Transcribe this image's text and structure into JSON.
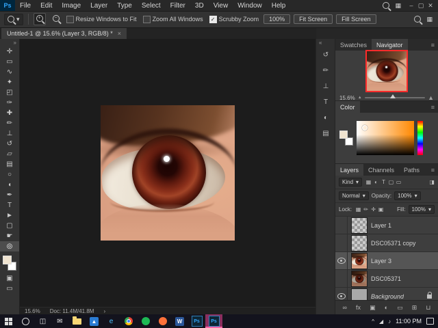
{
  "app": {
    "logo": "Ps"
  },
  "ui": {
    "caret": "▾",
    "panel_menu": "≡",
    "workspace_glyph": "▦",
    "check_glyph": "✓"
  },
  "menu_bar": {
    "items": [
      "File",
      "Edit",
      "Image",
      "Layer",
      "Type",
      "Select",
      "Filter",
      "3D",
      "View",
      "Window",
      "Help"
    ]
  },
  "window_controls": [
    {
      "name": "minimize",
      "glyph": "–"
    },
    {
      "name": "restore",
      "glyph": "▢"
    },
    {
      "name": "close",
      "glyph": "✕"
    }
  ],
  "options_bar": {
    "zoom_in_glyph": "+",
    "zoom_out_glyph": "−",
    "checkboxes": [
      {
        "label": "Resize Windows to Fit",
        "checked": false
      },
      {
        "label": "Zoom All Windows",
        "checked": false
      },
      {
        "label": "Scrubby Zoom",
        "checked": true
      }
    ],
    "buttons": [
      "100%",
      "Fit Screen",
      "Fill Screen"
    ]
  },
  "document": {
    "tab_title": "Untitled-1 @ 15.6% (Layer 3, RGB/8) *",
    "close_glyph": "×",
    "status_zoom": "15.6%",
    "status_doc": "Doc: 11.4M/41.8M",
    "status_expand_glyph": "›"
  },
  "toolbar": {
    "collapse_glyph": "»",
    "foreground_color": "#f0e4d0",
    "background_color": "#ffffff",
    "tools": [
      {
        "name": "move",
        "glyph": "✛"
      },
      {
        "name": "rectangular-marquee",
        "glyph": "▭"
      },
      {
        "name": "lasso",
        "glyph": "∿"
      },
      {
        "name": "quick-selection",
        "glyph": "✦"
      },
      {
        "name": "crop",
        "glyph": "◰"
      },
      {
        "name": "eyedropper",
        "glyph": "✑"
      },
      {
        "name": "spot-healing-brush",
        "glyph": "✚"
      },
      {
        "name": "brush",
        "glyph": "✏"
      },
      {
        "name": "clone-stamp",
        "glyph": "⊥"
      },
      {
        "name": "history-brush",
        "glyph": "↺"
      },
      {
        "name": "eraser",
        "glyph": "▱"
      },
      {
        "name": "gradient",
        "glyph": "▤"
      },
      {
        "name": "blur",
        "glyph": "○"
      },
      {
        "name": "dodge",
        "glyph": "◖"
      },
      {
        "name": "pen",
        "glyph": "✒"
      },
      {
        "name": "type",
        "glyph": "T"
      },
      {
        "name": "path-selection",
        "glyph": "►"
      },
      {
        "name": "rectangle",
        "glyph": "▢"
      },
      {
        "name": "hand",
        "glyph": "☛"
      },
      {
        "name": "zoom",
        "glyph": "◎",
        "active": true
      }
    ],
    "extra": [
      {
        "name": "quick-mask",
        "glyph": "▣"
      },
      {
        "name": "screen-mode",
        "glyph": "▭"
      }
    ]
  },
  "panel_strip": {
    "collapse_glyph": "«",
    "icons": [
      {
        "name": "history",
        "glyph": "↺"
      },
      {
        "name": "brush-settings",
        "glyph": "✏"
      },
      {
        "name": "clone-source",
        "glyph": "⊥"
      },
      {
        "name": "character",
        "glyph": "T"
      },
      {
        "name": "adjustments",
        "glyph": "◐"
      },
      {
        "name": "info",
        "glyph": "▤"
      }
    ]
  },
  "navigator": {
    "tabs": [
      {
        "label": "Swatches",
        "active": false
      },
      {
        "label": "Navigator",
        "active": true
      }
    ],
    "zoom": "15.6%",
    "zoom_out_glyph": "▲",
    "zoom_in_glyph": "▲"
  },
  "color_panel": {
    "tab": "Color"
  },
  "layers_panel": {
    "tabs": [
      {
        "label": "Layers",
        "active": true
      },
      {
        "label": "Channels",
        "active": false
      },
      {
        "label": "Paths",
        "active": false
      }
    ],
    "filter_label": "Kind",
    "filter_icons": [
      {
        "name": "pixel-layer-filter",
        "glyph": "▦"
      },
      {
        "name": "adjustment-layer-filter",
        "glyph": "◐"
      },
      {
        "name": "type-layer-filter",
        "glyph": "T"
      },
      {
        "name": "shape-layer-filter",
        "glyph": "▢"
      },
      {
        "name": "smart-object-filter",
        "glyph": "▭"
      }
    ],
    "filter_toggle_glyph": "◨",
    "blend_mode": "Normal",
    "opacity_label": "Opacity:",
    "opacity_value": "100%",
    "lock_label": "Lock:",
    "lock_icons": [
      {
        "name": "lock-transparent-pixels",
        "glyph": "▦"
      },
      {
        "name": "lock-image-pixels",
        "glyph": "✏"
      },
      {
        "name": "lock-position",
        "glyph": "✛"
      },
      {
        "name": "lock-artboard",
        "glyph": "▣"
      }
    ],
    "fill_label": "Fill:",
    "fill_value": "100%",
    "layers": [
      {
        "name": "Layer 1",
        "visible": false,
        "thumb": "checker",
        "selected": false,
        "locked": false
      },
      {
        "name": "DSC05371 copy",
        "visible": false,
        "thumb": "checker",
        "selected": false,
        "locked": false
      },
      {
        "name": "Layer 3",
        "visible": true,
        "thumb": "eye",
        "selected": true,
        "locked": false
      },
      {
        "name": "DSC05371",
        "visible": false,
        "thumb": "eye-dark",
        "selected": false,
        "locked": false
      },
      {
        "name": "Background",
        "visible": true,
        "thumb": "gray",
        "selected": false,
        "locked": true,
        "italic": true
      }
    ],
    "bottom_icons": [
      {
        "name": "link-layers",
        "glyph": "∞"
      },
      {
        "name": "layer-effects",
        "glyph": "fx"
      },
      {
        "name": "layer-mask",
        "glyph": "▣"
      },
      {
        "name": "adjustment-layer",
        "glyph": "◐"
      },
      {
        "name": "layer-group",
        "glyph": "▭"
      },
      {
        "name": "new-layer",
        "glyph": "⊞"
      },
      {
        "name": "delete-layer",
        "glyph": "⊔"
      }
    ]
  },
  "taskbar": {
    "time": "11:00 PM",
    "tray_icons": [
      {
        "name": "hidden-icons",
        "glyph": "^"
      },
      {
        "name": "network",
        "glyph": "◢"
      },
      {
        "name": "volume",
        "glyph": "♪"
      }
    ],
    "apps": [
      {
        "name": "start",
        "type": "start"
      },
      {
        "name": "search",
        "type": "circle"
      },
      {
        "name": "task-view",
        "type": "glyph",
        "glyph": "◫"
      },
      {
        "name": "mail",
        "type": "glyph",
        "glyph": "✉"
      },
      {
        "name": "file-explorer",
        "type": "folder"
      },
      {
        "name": "photos",
        "type": "square",
        "glyph": "▲",
        "color": "#2b7cd3"
      },
      {
        "name": "edge",
        "type": "glyph",
        "glyph": "e",
        "color": "#4cc2ff"
      },
      {
        "name": "chrome",
        "type": "chrome"
      },
      {
        "name": "spotify",
        "type": "ball",
        "color": "#1db954"
      },
      {
        "name": "firefox",
        "type": "ball",
        "color": "#ff7139"
      },
      {
        "name": "word",
        "type": "square",
        "glyph": "W",
        "color": "#2b579a"
      },
      {
        "name": "photoshop",
        "type": "ps"
      },
      {
        "name": "photoshop-active",
        "type": "ps",
        "active": true
      }
    ]
  }
}
